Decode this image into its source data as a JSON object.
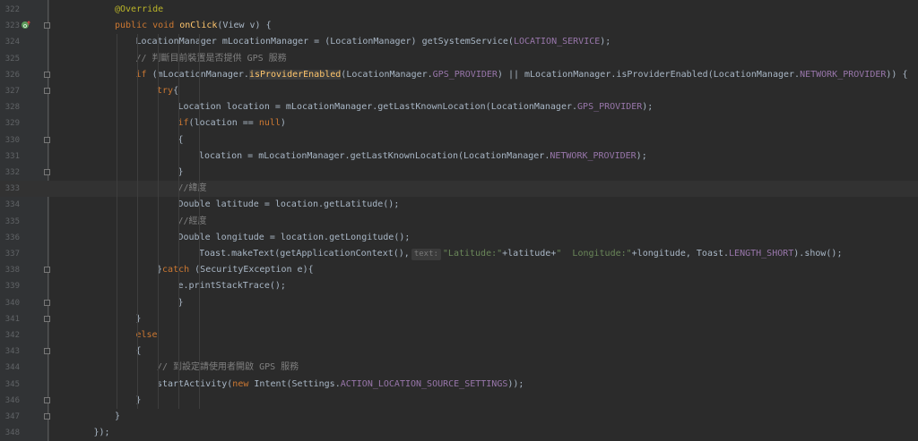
{
  "editor": {
    "current_line": 333,
    "lines": [
      {
        "n": "322",
        "i": 3,
        "t": [
          [
            "ann",
            "@Override"
          ]
        ]
      },
      {
        "n": "323",
        "i": 3,
        "t": [
          [
            "kw",
            "public void "
          ],
          [
            "fn",
            "onClick"
          ],
          [
            "p",
            "(View v) {"
          ]
        ]
      },
      {
        "n": "324",
        "i": 4,
        "t": [
          [
            "p",
            "LocationManager mLocationManager = (LocationManager) getSystemService("
          ],
          [
            "cst",
            "LOCATION_SERVICE"
          ],
          [
            "p",
            ");"
          ]
        ]
      },
      {
        "n": "325",
        "i": 4,
        "t": [
          [
            "cmt",
            "// 判斷目前裝置是否提供 GPS 服務"
          ]
        ]
      },
      {
        "n": "326",
        "i": 4,
        "t": [
          [
            "kw",
            "if "
          ],
          [
            "p",
            "(mLocationManager."
          ],
          [
            "hl",
            "isProviderEnabled"
          ],
          [
            "p",
            "(LocationManager."
          ],
          [
            "cst",
            "GPS_PROVIDER"
          ],
          [
            "p",
            ") || mLocationManager.isProviderEnabled(LocationManager."
          ],
          [
            "cst",
            "NETWORK_PROVIDER"
          ],
          [
            "p",
            ")) {"
          ]
        ]
      },
      {
        "n": "327",
        "i": 5,
        "t": [
          [
            "kw",
            "try"
          ],
          [
            "p",
            "{"
          ]
        ]
      },
      {
        "n": "328",
        "i": 6,
        "t": [
          [
            "p",
            "Location location = mLocationManager.getLastKnownLocation(LocationManager."
          ],
          [
            "cst",
            "GPS_PROVIDER"
          ],
          [
            "p",
            ");"
          ]
        ]
      },
      {
        "n": "329",
        "i": 6,
        "t": [
          [
            "kw",
            "if"
          ],
          [
            "p",
            "(location == "
          ],
          [
            "kw",
            "null"
          ],
          [
            "p",
            ")"
          ]
        ]
      },
      {
        "n": "330",
        "i": 6,
        "t": [
          [
            "p",
            "{"
          ]
        ]
      },
      {
        "n": "331",
        "i": 7,
        "t": [
          [
            "p",
            "location = mLocationManager.getLastKnownLocation(LocationManager."
          ],
          [
            "cst",
            "NETWORK_PROVIDER"
          ],
          [
            "p",
            ");"
          ]
        ]
      },
      {
        "n": "332",
        "i": 6,
        "t": [
          [
            "p",
            "}"
          ]
        ]
      },
      {
        "n": "333",
        "i": 6,
        "t": [
          [
            "cmt",
            "//緯度"
          ]
        ]
      },
      {
        "n": "334",
        "i": 6,
        "t": [
          [
            "p",
            "Double latitude = location.getLatitude();"
          ]
        ]
      },
      {
        "n": "335",
        "i": 6,
        "t": [
          [
            "cmt",
            "//經度"
          ]
        ]
      },
      {
        "n": "336",
        "i": 6,
        "t": [
          [
            "p",
            "Double longitude = location.getLongitude();"
          ]
        ]
      },
      {
        "n": "337",
        "i": 7,
        "t": [
          [
            "p",
            "Toast.makeText(getApplicationContext(),"
          ],
          [
            "hint",
            "text:"
          ],
          [
            "str",
            "\"Latitude:\""
          ],
          [
            "p",
            "+latitude+"
          ],
          [
            "str",
            "\"  Longitude:\""
          ],
          [
            "p",
            "+longitude, Toast."
          ],
          [
            "cst",
            "LENGTH_SHORT"
          ],
          [
            "p",
            ").show();"
          ]
        ]
      },
      {
        "n": "338",
        "i": 5,
        "t": [
          [
            "p",
            "}"
          ],
          [
            "kw",
            "catch "
          ],
          [
            "p",
            "(SecurityException e){"
          ]
        ]
      },
      {
        "n": "339",
        "i": 6,
        "t": [
          [
            "p",
            "e.printStackTrace();"
          ]
        ]
      },
      {
        "n": "340",
        "i": 6,
        "t": [
          [
            "p",
            "}"
          ]
        ]
      },
      {
        "n": "341",
        "i": 4,
        "t": [
          [
            "p",
            "}"
          ]
        ]
      },
      {
        "n": "342",
        "i": 4,
        "t": [
          [
            "kw",
            "else"
          ]
        ]
      },
      {
        "n": "343",
        "i": 4,
        "t": [
          [
            "p",
            "{"
          ]
        ]
      },
      {
        "n": "344",
        "i": 5,
        "t": [
          [
            "cmt",
            "// 到設定請使用者開啟 GPS 服務"
          ]
        ]
      },
      {
        "n": "345",
        "i": 5,
        "t": [
          [
            "p",
            "startActivity("
          ],
          [
            "kw",
            "new "
          ],
          [
            "p",
            "Intent(Settings."
          ],
          [
            "cst",
            "ACTION_LOCATION_SOURCE_SETTINGS"
          ],
          [
            "p",
            "));"
          ]
        ]
      },
      {
        "n": "346",
        "i": 4,
        "t": [
          [
            "p",
            "}"
          ]
        ]
      },
      {
        "n": "347",
        "i": 3,
        "t": [
          [
            "p",
            "}"
          ]
        ]
      },
      {
        "n": "348",
        "i": 2,
        "t": [
          [
            "p",
            "});"
          ]
        ]
      }
    ]
  }
}
